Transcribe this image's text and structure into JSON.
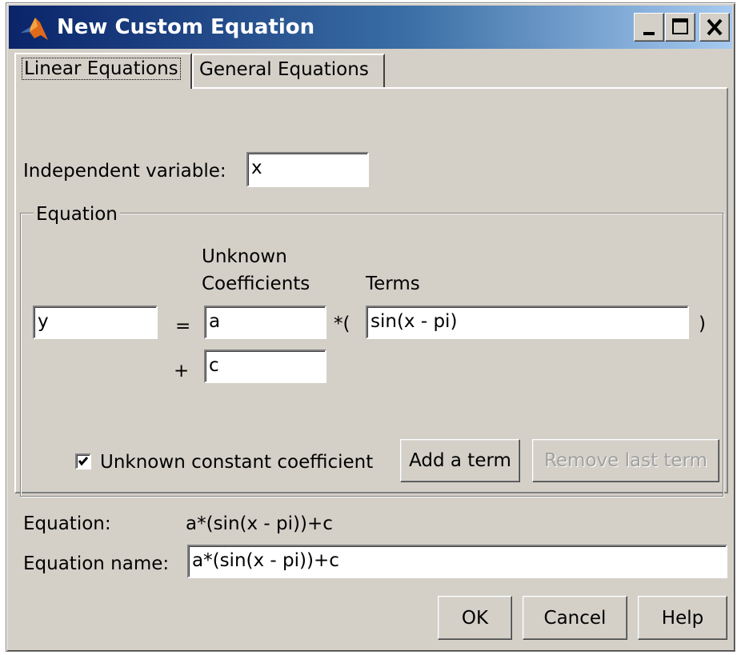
{
  "window": {
    "title": "New Custom Equation"
  },
  "tabs": [
    {
      "label": "Linear Equations",
      "active": true
    },
    {
      "label": "General Equations",
      "active": false
    }
  ],
  "independent_variable": {
    "label": "Independent variable:",
    "value": "x"
  },
  "equation_group": {
    "legend": "Equation",
    "coefficients_header_line1": "Unknown",
    "coefficients_header_line2": "Coefficients",
    "terms_header": "Terms",
    "dependent_value": "y",
    "equals": "=",
    "plus": "+",
    "multiply_open": "*(",
    "close_paren": ")",
    "coefficient_1": "a",
    "term_1": "sin(x - pi)",
    "constant_coefficient": "c",
    "unknown_constant_label": "Unknown constant coefficient",
    "unknown_constant_checked": true,
    "add_term_label": "Add a term",
    "remove_term_label": "Remove last term"
  },
  "equation_display": {
    "label": "Equation:",
    "value": "a*(sin(x - pi))+c"
  },
  "equation_name": {
    "label": "Equation name:",
    "value": "a*(sin(x - pi))+c"
  },
  "buttons": {
    "ok": "OK",
    "cancel": "Cancel",
    "help": "Help"
  },
  "icons": {
    "app": "matlab-logo-icon",
    "minimize": "minimize-icon",
    "maximize": "maximize-icon",
    "close": "close-icon",
    "checkmark": "checkmark-icon"
  },
  "colors": {
    "title_start": "#0a246a",
    "title_end": "#a6caf0",
    "face": "#d4d0c8"
  }
}
